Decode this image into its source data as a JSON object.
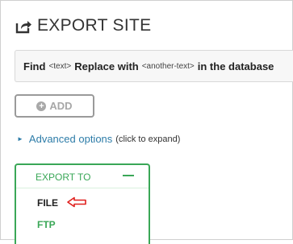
{
  "header": {
    "title": "EXPORT SITE",
    "icon": "export-icon"
  },
  "find_replace": {
    "find_label": "Find",
    "find_placeholder": "<text>",
    "replace_label": "Replace with",
    "replace_placeholder": "<another-text>",
    "suffix": "in the database"
  },
  "add_button": {
    "label": "ADD",
    "icon": "plus-circle-icon"
  },
  "advanced": {
    "link_label": "Advanced options",
    "hint": "(click to expand)"
  },
  "export_panel": {
    "title": "EXPORT TO",
    "options": [
      {
        "label": "FILE"
      },
      {
        "label": "FTP"
      }
    ]
  },
  "colors": {
    "accent_green": "#3aa757",
    "link_blue": "#2d7ca8",
    "annotation_red": "#e0201e",
    "muted_gray": "#a8a8a8"
  }
}
